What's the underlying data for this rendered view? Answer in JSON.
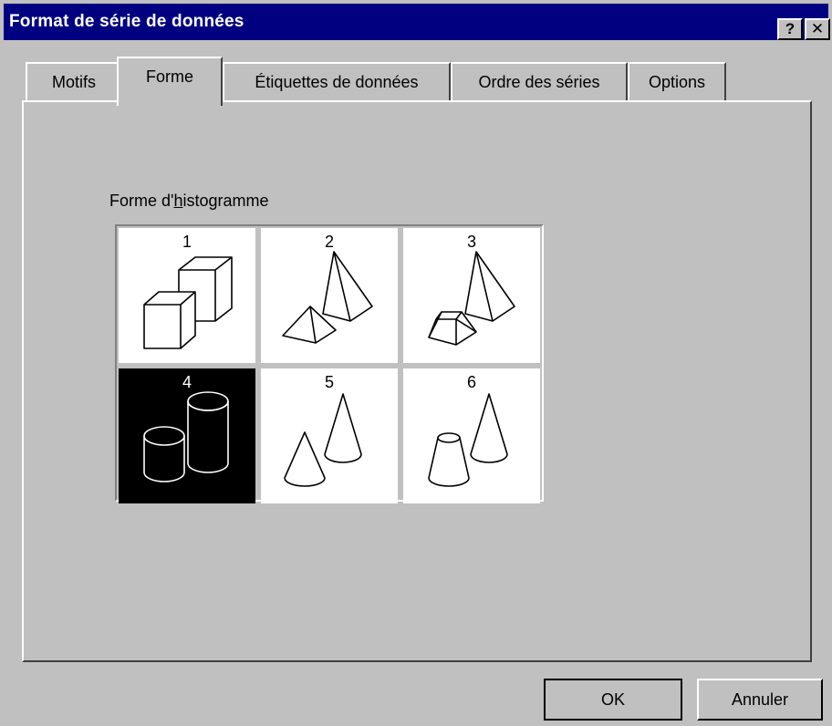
{
  "window": {
    "title": "Format de série de données",
    "help_label": "?",
    "close_label": "✕"
  },
  "tabs": [
    {
      "label": "Motifs"
    },
    {
      "label": "Forme",
      "active": true
    },
    {
      "label": "Étiquettes de données"
    },
    {
      "label": "Ordre des séries"
    },
    {
      "label": "Options"
    }
  ],
  "shape_group": {
    "label_pre": "Forme d'",
    "label_underlined": "h",
    "label_post": "istogramme",
    "selected": "4",
    "options": [
      {
        "number": "1",
        "icon": "box-icon"
      },
      {
        "number": "2",
        "icon": "pyramid-icon"
      },
      {
        "number": "3",
        "icon": "truncated-pyramid-icon"
      },
      {
        "number": "4",
        "icon": "cylinder-icon"
      },
      {
        "number": "5",
        "icon": "cone-icon"
      },
      {
        "number": "6",
        "icon": "truncated-cone-icon"
      }
    ]
  },
  "buttons": {
    "ok_label": "OK",
    "cancel_label": "Annuler"
  }
}
